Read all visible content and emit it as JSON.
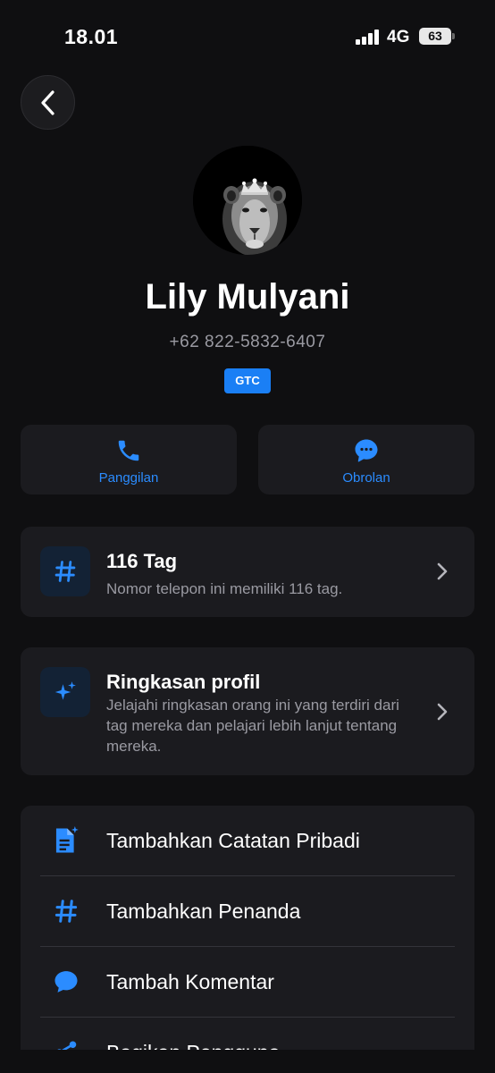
{
  "status_bar": {
    "time": "18.01",
    "network": "4G",
    "battery": "63"
  },
  "profile": {
    "name": "Lily Mulyani",
    "phone": "+62 822-5832-6407",
    "badge": "GTC"
  },
  "actions": [
    {
      "label": "Panggilan",
      "icon": "phone-icon"
    },
    {
      "label": "Obrolan",
      "icon": "chat-bubble-icon"
    }
  ],
  "tags_card": {
    "title": "116 Tag",
    "description": "Nomor telepon ini memiliki 116 tag.",
    "icon": "hashtag-icon"
  },
  "summary_card": {
    "title": "Ringkasan profil",
    "description": "Jelajahi ringkasan orang ini yang terdiri dari tag mereka dan pelajari lebih lanjut tentang mereka.",
    "icon": "sparkles-icon"
  },
  "menu": [
    {
      "label": "Tambahkan Catatan Pribadi",
      "icon": "note-sparkle-icon"
    },
    {
      "label": "Tambahkan Penanda",
      "icon": "hashtag-icon"
    },
    {
      "label": "Tambah Komentar",
      "icon": "comment-icon"
    },
    {
      "label": "Bagikan Pengguna",
      "icon": "share-icon"
    }
  ],
  "colors": {
    "background": "#0f0f11",
    "card": "#1b1b1f",
    "accent": "#1a7ff5",
    "muted_text": "#9a9aa2"
  }
}
